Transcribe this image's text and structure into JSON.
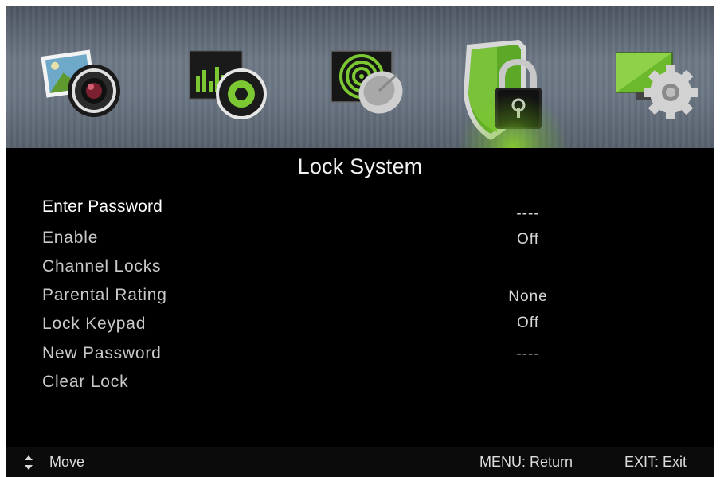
{
  "tabs": [
    {
      "name": "picture",
      "active": false
    },
    {
      "name": "audio",
      "active": false
    },
    {
      "name": "channel",
      "active": false
    },
    {
      "name": "lock",
      "active": true
    },
    {
      "name": "setup",
      "active": false
    }
  ],
  "title": "Lock System",
  "menu": {
    "items": [
      {
        "label": "Enter Password",
        "value": "----"
      },
      {
        "label": "Enable",
        "value": "Off"
      },
      {
        "label": "Channel Locks",
        "value": ""
      },
      {
        "label": "Parental Rating",
        "value": "None"
      },
      {
        "label": "Lock Keypad",
        "value": "Off"
      },
      {
        "label": "New Password",
        "value": "----"
      },
      {
        "label": "Clear Lock",
        "value": ""
      }
    ],
    "selected_index": 0
  },
  "footer": {
    "move_label": "Move",
    "return_label": "MENU: Return",
    "exit_label": "EXIT: Exit"
  },
  "colors": {
    "accent_green": "#7cc832",
    "background": "#000000",
    "text": "#d6d6d6"
  }
}
